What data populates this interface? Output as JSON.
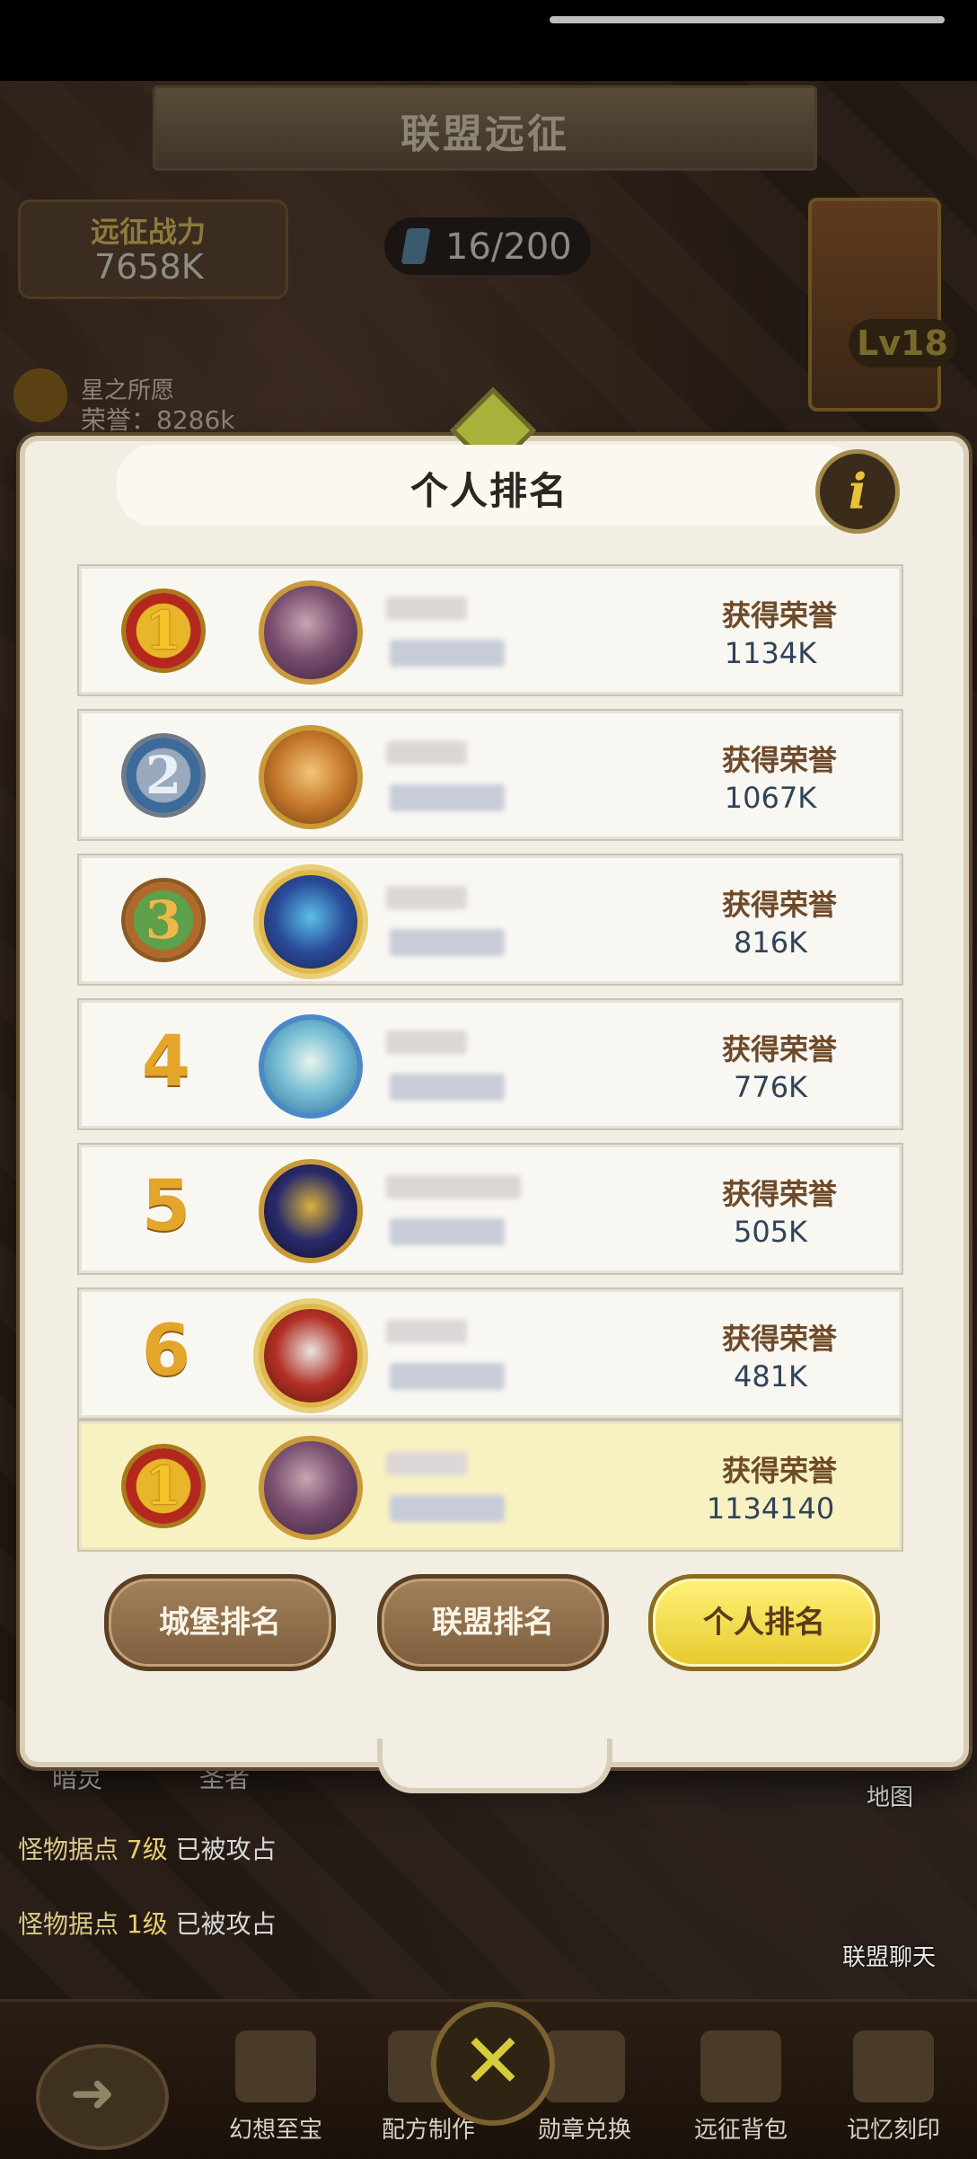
{
  "background": {
    "title": "联盟远征",
    "power_label": "远征战力",
    "power_value": "7658K",
    "gems": "16/200",
    "level": "Lv18",
    "guild_name": "星之所愿",
    "guild_honor": "荣誉：8286k",
    "labels": {
      "dark": "暗灵",
      "saint": "圣者",
      "map": "地图",
      "chat": "联盟聊天"
    },
    "monster_lines": [
      {
        "prefix": "怪物据点",
        "level": "7级",
        "status": "已被攻占"
      },
      {
        "prefix": "怪物据点",
        "level": "1级",
        "status": "已被攻占"
      }
    ]
  },
  "toolbar": {
    "items": [
      "幻想至宝",
      "配方制作",
      "勋章兑换",
      "远征背包",
      "记忆刻印"
    ]
  },
  "modal": {
    "title": "个人排名",
    "info_glyph": "i",
    "rows": [
      {
        "rank": "1",
        "honor_label": "获得荣誉",
        "honor": "1134K"
      },
      {
        "rank": "2",
        "honor_label": "获得荣誉",
        "honor": "1067K"
      },
      {
        "rank": "3",
        "honor_label": "获得荣誉",
        "honor": "816K"
      },
      {
        "rank": "4",
        "honor_label": "获得荣誉",
        "honor": "776K"
      },
      {
        "rank": "5",
        "honor_label": "获得荣誉",
        "honor": "505K"
      },
      {
        "rank": "6",
        "honor_label": "获得荣誉",
        "honor": "481K"
      }
    ],
    "self_row": {
      "rank": "1",
      "honor_label": "获得荣誉",
      "honor": "1134140"
    },
    "tabs": [
      {
        "label": "城堡排名",
        "active": false
      },
      {
        "label": "联盟排名",
        "active": false
      },
      {
        "label": "个人排名",
        "active": true
      }
    ]
  },
  "colors": {
    "active_tab": "#f0d63a",
    "inactive_tab": "#8f6e4a",
    "honor_label": "#6e4a2a",
    "honor_value": "#31435a"
  }
}
